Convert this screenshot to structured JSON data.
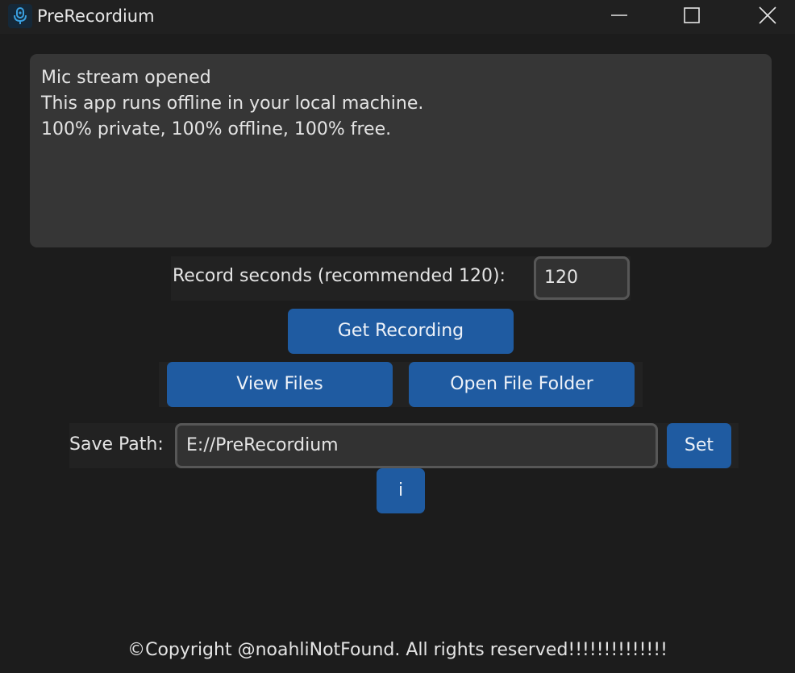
{
  "window": {
    "title": "PreRecordium",
    "icon": "microphone-app-icon"
  },
  "log": {
    "lines": [
      "Mic stream opened",
      "This app runs offline in your local machine.",
      "100% private, 100% offline, 100% free."
    ]
  },
  "record": {
    "label": "Record seconds (recommended 120):",
    "value": "120"
  },
  "buttons": {
    "get_recording": "Get Recording",
    "view_files": "View Files",
    "open_file_folder": "Open File Folder",
    "set": "Set",
    "info": "i"
  },
  "save_path": {
    "label": "Save Path:",
    "value": "E://PreRecordium"
  },
  "footer": {
    "copyright": "©Copyright @noahliNotFound. All rights reserved!!!!!!!!!!!!!!"
  },
  "colors": {
    "background": "#1c1c1c",
    "accent": "#1f5ba1",
    "panel": "#363636"
  }
}
